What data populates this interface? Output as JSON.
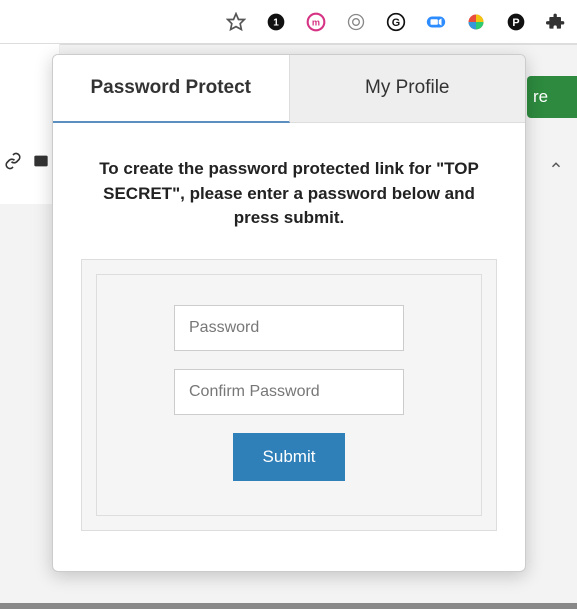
{
  "browser": {
    "icons": {
      "star": "star-icon",
      "overflow": "overflow-icon",
      "ext1": "circle-1-icon",
      "ext2": "m-red-icon",
      "ext3": "clock-icon",
      "ext4": "grammarly-icon",
      "ext5": "zoom-icon",
      "ext6": "color-wheel-icon",
      "ext7": "p-black-icon",
      "puzzle": "extensions-icon"
    }
  },
  "page": {
    "share_fragment": "re",
    "left_icons": {
      "link": "link-icon",
      "plus": "plus-icon"
    }
  },
  "popup": {
    "tabs": {
      "password_protect": "Password Protect",
      "my_profile": "My Profile"
    },
    "instruction": "To create the password protected link for \"TOP SECRET\", please enter a password below and press submit.",
    "form": {
      "password_placeholder": "Password",
      "confirm_placeholder": "Confirm Password",
      "submit_label": "Submit"
    }
  }
}
